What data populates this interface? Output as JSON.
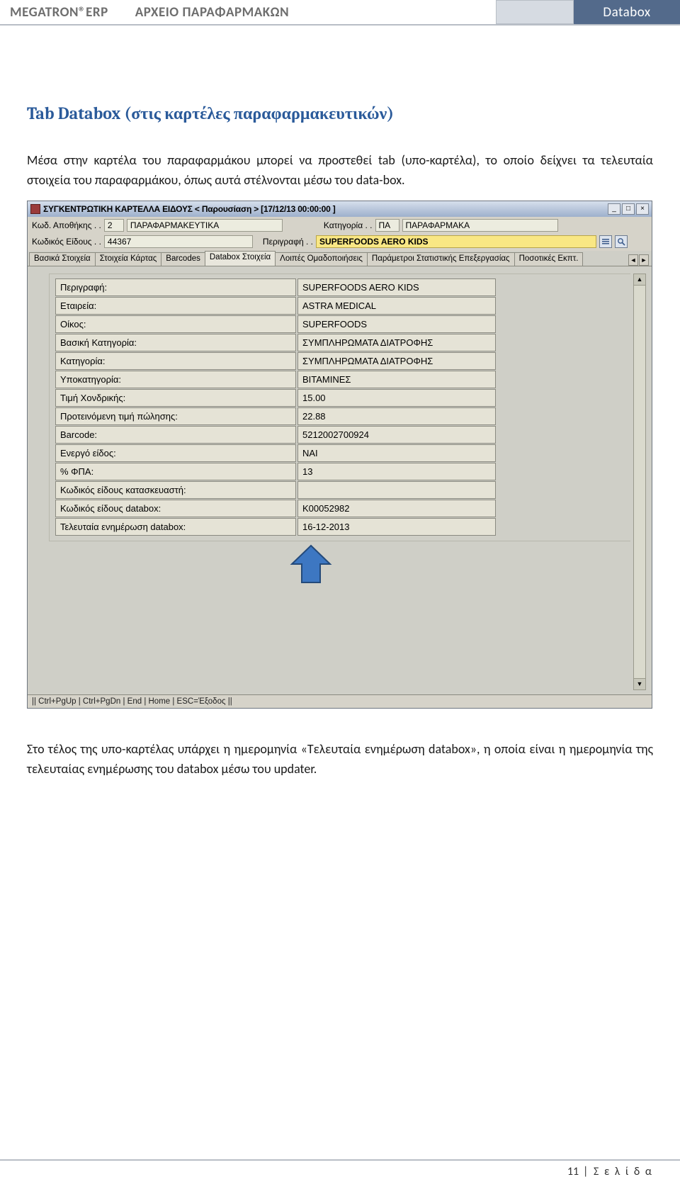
{
  "doc_header": {
    "left": "MEGATRON®ERP",
    "mid": "ΑΡΧΕΙΟ ΠΑΡΑΦΑΡΜΑΚΩΝ",
    "badge": "Databox"
  },
  "section_title": "Tab Databox (στις καρτέλες παραφαρμακευτικών)",
  "paragraph1": "Μέσα στην καρτέλα του παραφαρμάκου μπορεί να προστεθεί tab (υπο-καρτέλα), το οποίο δείχνει τα τελευταία στοιχεία του παραφαρμάκου, όπως αυτά στέλνονται μέσω του data-box.",
  "screenshot": {
    "titlebar": "ΣΥΓΚΕΝΤΡΩΤΙΚΗ ΚΑΡΤΕΛΛΑ ΕΙΔΟΥΣ < Παρουσίαση >   [17/12/13 00:00:00  ]",
    "row1": {
      "label_warehouse": "Κωδ. Αποθήκης . .",
      "warehouse_code": "2",
      "warehouse_name": "ΠΑΡΑΦΑΡΜΑΚΕΥΤΙΚΑ",
      "label_category": "Κατηγορία . .",
      "category_code": "ΠΑ",
      "category_name": "ΠΑΡΑΦΑΡΜΑΚΑ"
    },
    "row2": {
      "label_item": "Κωδικός Είδους . .",
      "item_code": "44367",
      "label_desc": "Περιγραφή . .",
      "desc": "SUPERFOODS AERO KIDS"
    },
    "tabs": [
      "Βασικά Στοιχεία",
      "Στοιχεία Κάρτας",
      "Barcodes",
      "Databox Στοιχεία",
      "Λοιπές Ομαδοποιήσεις",
      "Παράμετροι Στατιστικής Επεξεργασίας",
      "Ποσοτικές Εκπτ."
    ],
    "active_tab_index": 3,
    "details": [
      {
        "label": "Περιγραφή:",
        "value": "SUPERFOODS AERO KIDS"
      },
      {
        "label": "Εταιρεία:",
        "value": "ASTRA MEDICAL"
      },
      {
        "label": "Οίκος:",
        "value": "SUPERFOODS"
      },
      {
        "label": "Βασική Κατηγορία:",
        "value": "ΣΥΜΠΛΗΡΩΜΑΤΑ ΔΙΑΤΡΟΦΗΣ"
      },
      {
        "label": "Κατηγορία:",
        "value": "ΣΥΜΠΛΗΡΩΜΑΤΑ ΔΙΑΤΡΟΦΗΣ"
      },
      {
        "label": "Υποκατηγορία:",
        "value": "ΒΙΤΑΜΙΝΕΣ"
      },
      {
        "label": "Τιμή Χονδρικής:",
        "value": "15.00"
      },
      {
        "label": "Προτεινόμενη τιμή πώλησης:",
        "value": "22.88"
      },
      {
        "label": "Barcode:",
        "value": "5212002700924"
      },
      {
        "label": "Ενεργό είδος:",
        "value": "ΝΑΙ"
      },
      {
        "label": "% ΦΠΑ:",
        "value": "13"
      },
      {
        "label": "Κωδικός είδους κατασκευαστή:",
        "value": ""
      },
      {
        "label": "Κωδικός είδους databox:",
        "value": "K00052982"
      },
      {
        "label": "Τελευταία ενημέρωση databox:",
        "value": "16-12-2013"
      }
    ],
    "statusbar": "|| Ctrl+PgUp | Ctrl+PgDn | End | Home | ESC=Έξοδος ||"
  },
  "paragraph2_pre": "Στο τέλος της υπο-καρτέλας υπάρχει η ημερομηνία «",
  "paragraph2_bold": "Τελευταία ενημέρωση databox",
  "paragraph2_post": "», η οποία είναι η ημερομηνία της τελευταίας ενημέρωσης του databox μέσω του updater.",
  "footer": {
    "page_num": "11",
    "page_word": "Σ ε λ ί δ α"
  }
}
